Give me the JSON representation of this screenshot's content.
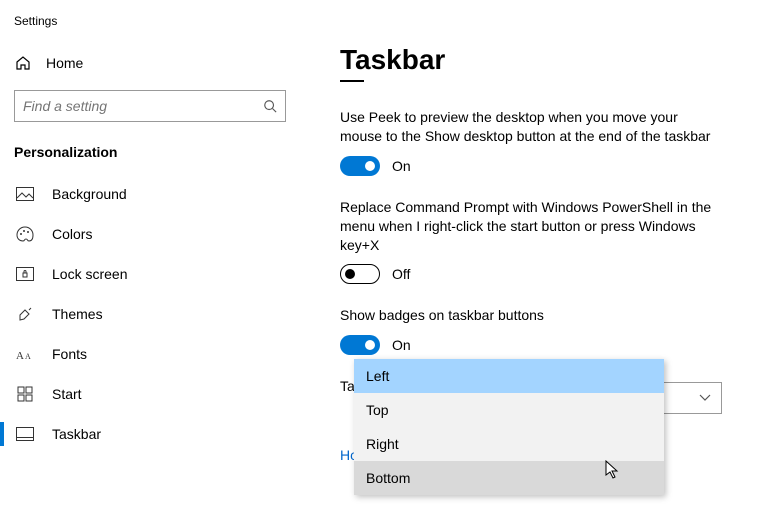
{
  "app_title": "Settings",
  "home_label": "Home",
  "search_placeholder": "Find a setting",
  "category": "Personalization",
  "nav": [
    {
      "label": "Background"
    },
    {
      "label": "Colors"
    },
    {
      "label": "Lock screen"
    },
    {
      "label": "Themes"
    },
    {
      "label": "Fonts"
    },
    {
      "label": "Start"
    },
    {
      "label": "Taskbar"
    }
  ],
  "page_title": "Taskbar",
  "settings": {
    "peek": {
      "desc": "Use Peek to preview the desktop when you move your mouse to the Show desktop button at the end of the taskbar",
      "state": "On"
    },
    "powershell": {
      "desc": "Replace Command Prompt with Windows PowerShell in the menu when I right-click the start button or press Windows key+X",
      "state": "Off"
    },
    "badges": {
      "desc": "Show badges on taskbar buttons",
      "state": "On"
    },
    "location": {
      "desc": "Taskbar location on screen"
    }
  },
  "dropdown": {
    "options": [
      "Left",
      "Top",
      "Right",
      "Bottom"
    ]
  },
  "help_link": "How do I customize taskbars?"
}
